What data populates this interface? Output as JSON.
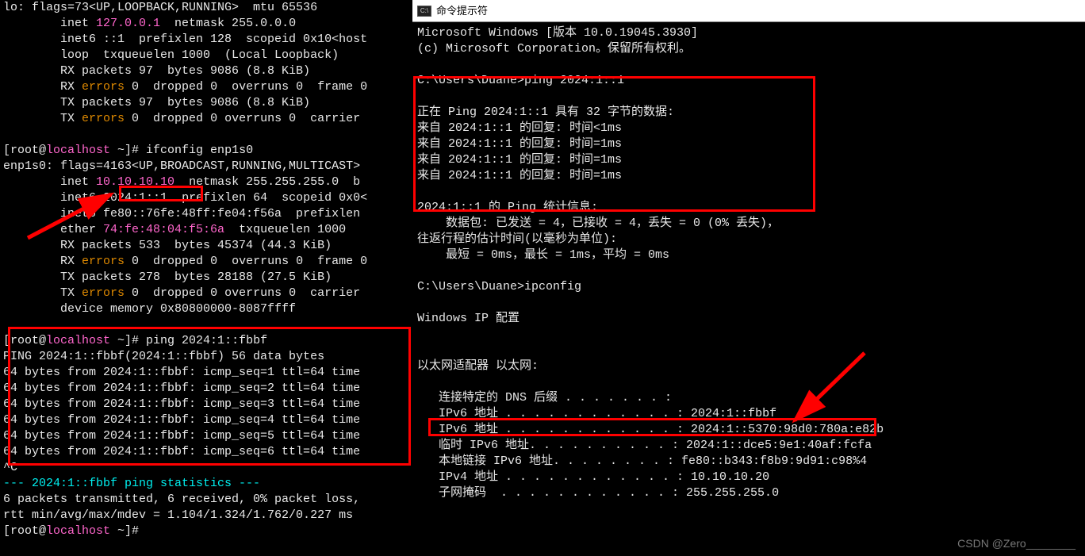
{
  "left": {
    "line0": "lo: flags=73<UP,LOOPBACK,RUNNING>  mtu 65536",
    "line1_a": "        inet ",
    "line1_b": "127.0.0.1",
    "line1_c": "  netmask 255.0.0.0",
    "line2": "        inet6 ::1  prefixlen 128  scopeid 0x10<host",
    "line3": "        loop  txqueuelen 1000  (Local Loopback)",
    "line4": "        RX packets 97  bytes 9086 (8.8 KiB)",
    "line5_a": "        RX ",
    "line5_err": "errors",
    "line5_b": " 0  dropped 0  overruns 0  frame 0",
    "line6": "        TX packets 97  bytes 9086 (8.8 KiB)",
    "line7_a": "        TX ",
    "line7_err": "errors",
    "line7_b": " 0  dropped 0 overruns 0  carrier",
    "prompt1_a": "[root@",
    "prompt1_host": "localhost",
    "prompt1_b": " ~]# ",
    "cmd1": "ifconfig enp1s0",
    "line8": "enp1s0: flags=4163<UP,BROADCAST,RUNNING,MULTICAST>",
    "line9_a": "        inet ",
    "line9_b": "10.10.10.10",
    "line9_c": "  netmask 255.255.255.0  b",
    "line10_a": "        inet6 ",
    "line10_b": "2024:1::1  ",
    "line10_c": "prefixlen 64  scopeid 0x0<",
    "line11": "        inet6 fe80::76fe:48ff:fe04:f56a  prefixlen",
    "line12_a": "        ether ",
    "line12_b": "74:fe:48:04:f5:6a",
    "line12_c": "  txqueuelen 1000",
    "line13": "        RX packets 533  bytes 45374 (44.3 KiB)",
    "line14_a": "        RX ",
    "line14_err": "errors",
    "line14_b": " 0  dropped 0  overruns 0  frame 0",
    "line15": "        TX packets 278  bytes 28188 (27.5 KiB)",
    "line16_a": "        TX ",
    "line16_err": "errors",
    "line16_b": " 0  dropped 0 overruns 0  carrier",
    "line17": "        device memory 0x80800000-8087ffff",
    "cmd2": "ping 2024:1::fbbf",
    "ping_h": "PING 2024:1::fbbf(2024:1::fbbf) 56 data bytes",
    "ping1": "64 bytes from 2024:1::fbbf: icmp_seq=1 ttl=64 time",
    "ping2": "64 bytes from 2024:1::fbbf: icmp_seq=2 ttl=64 time",
    "ping3": "64 bytes from 2024:1::fbbf: icmp_seq=3 ttl=64 time",
    "ping4": "64 bytes from 2024:1::fbbf: icmp_seq=4 ttl=64 time",
    "ping5": "64 bytes from 2024:1::fbbf: icmp_seq=5 ttl=64 time",
    "ping6": "64 bytes from 2024:1::fbbf: icmp_seq=6 ttl=64 time",
    "ctrlc": "^C",
    "stat_h": "--- 2024:1::fbbf ping statistics ---",
    "stat1": "6 packets transmitted, 6 received, 0% packet loss,",
    "stat2": "rtt min/avg/max/mdev = 1.104/1.324/1.762/0.227 ms",
    "prompt3": " "
  },
  "right": {
    "title": "命令提示符",
    "l1": "Microsoft Windows [版本 10.0.19045.3930]",
    "l2": "(c) Microsoft Corporation。保留所有权利。",
    "prompt1": "C:\\Users\\Duane>",
    "cmd1": "ping 2024:1::1",
    "ph": "正在 Ping 2024:1::1 具有 32 字节的数据:",
    "p1": "来自 2024:1::1 的回复: 时间<1ms",
    "p2": "来自 2024:1::1 的回复: 时间=1ms",
    "p3": "来自 2024:1::1 的回复: 时间=1ms",
    "p4": "来自 2024:1::1 的回复: 时间=1ms",
    "stat_h": "2024:1::1 的 Ping 统计信息:",
    "stat1": "    数据包: 已发送 = 4，已接收 = 4，丢失 = 0 (0% 丢失)，",
    "stat2": "往返行程的估计时间(以毫秒为单位):",
    "stat3": "    最短 = 0ms，最长 = 1ms，平均 = 0ms",
    "cmd2": "ipconfig",
    "l3": "Windows IP 配置",
    "l4": "以太网适配器 以太网:",
    "ip1": "   连接特定的 DNS 后缀 . . . . . . . :",
    "ip2": "   IPv6 地址 . . . . . . . . . . . . : 2024:1::fbbf",
    "ip3": "   IPv6 地址 . . . . . . . . . . . . : 2024:1::5370:98d0:780a:e82b",
    "ip4": "   临时 IPv6 地址. . . . . . . . . . : 2024:1::dce5:9e1:40af:fcfa",
    "ip5": "   本地链接 IPv6 地址. . . . . . . . : fe80::b343:f8b9:9d91:c98%4",
    "ip6": "   IPv4 地址 . . . . . . . . . . . . : 10.10.10.20",
    "ip7": "   子网掩码  . . . . . . . . . . . . : 255.255.255.0"
  },
  "watermark": "CSDN @Zero________"
}
